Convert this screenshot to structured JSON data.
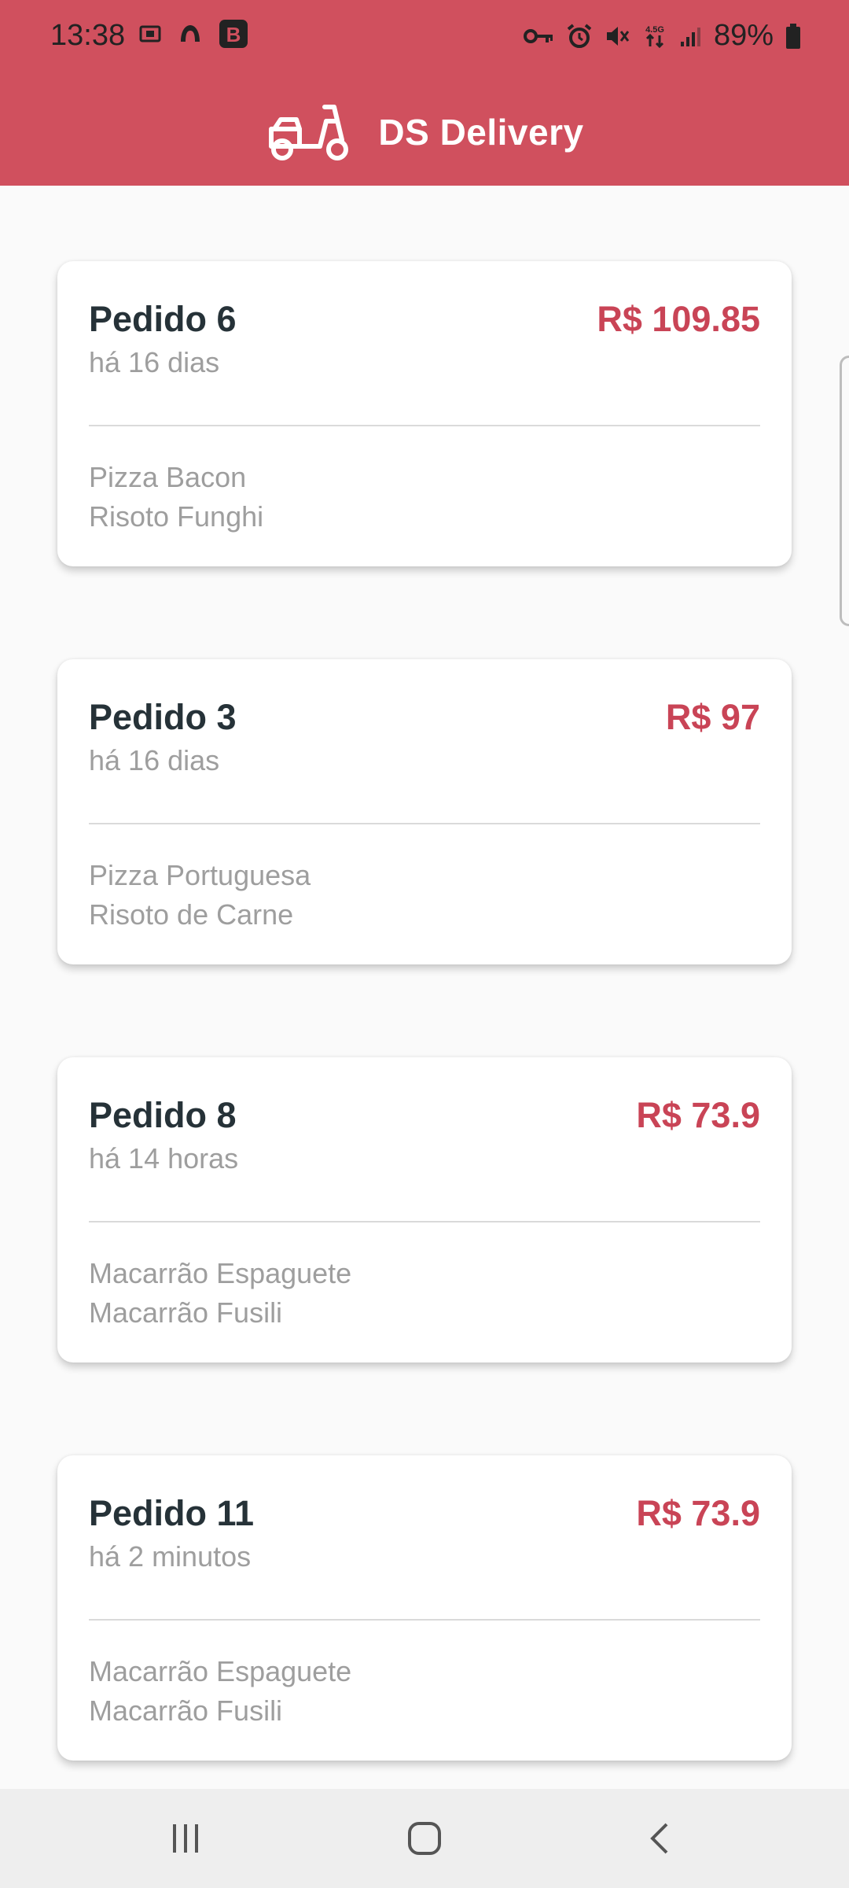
{
  "status_bar": {
    "time": "13:38",
    "battery": "89%",
    "left_icons": [
      "screenshot-icon",
      "app-icon",
      "b-app-icon"
    ],
    "right_icons": [
      "vpn-key-icon",
      "alarm-icon",
      "mute-icon",
      "network-4-5g-icon",
      "signal-icon",
      "battery-icon"
    ]
  },
  "header": {
    "title": "DS Delivery",
    "logo_icon": "delivery-scooter-icon",
    "background_color": "#D0505E"
  },
  "orders": [
    {
      "title": "Pedido 6",
      "price": "R$ 109.85",
      "time": "há 16 dias",
      "products": [
        "Pizza Bacon",
        "Risoto Funghi"
      ]
    },
    {
      "title": "Pedido 3",
      "price": "R$ 97",
      "time": "há 16 dias",
      "products": [
        "Pizza Portuguesa",
        "Risoto de Carne"
      ]
    },
    {
      "title": "Pedido 8",
      "price": "R$ 73.9",
      "time": "há 14 horas",
      "products": [
        "Macarrão Espaguete",
        "Macarrão Fusili"
      ]
    },
    {
      "title": "Pedido 11",
      "price": "R$ 73.9",
      "time": "há 2 minutos",
      "products": [
        "Macarrão Espaguete",
        "Macarrão Fusili"
      ]
    }
  ],
  "colors": {
    "accent": "#D0505E",
    "price": "#C94456",
    "title_text": "#263238",
    "secondary_text": "#9E9E9E"
  },
  "navigation": {
    "icons": [
      "recent-apps-icon",
      "home-icon",
      "back-icon"
    ]
  }
}
